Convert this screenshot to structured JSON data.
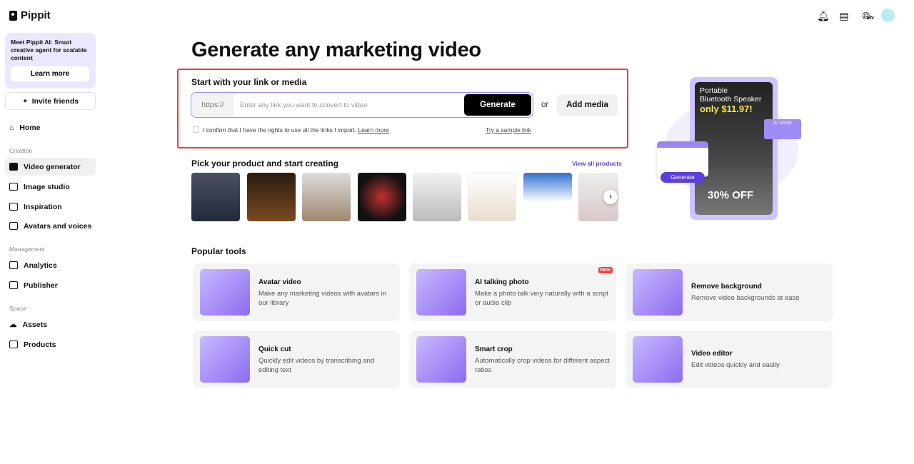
{
  "app": {
    "name": "Pippit"
  },
  "promo": {
    "text": "Meet Pippit AI: Smart creative agent for scalable content",
    "button": "Learn more"
  },
  "invite": "Invite friends",
  "nav": {
    "home": "Home",
    "creation": "Creation",
    "video_generator": "Video generator",
    "image_studio": "Image studio",
    "inspiration": "Inspiration",
    "avatars": "Avatars and voices",
    "management": "Management",
    "analytics": "Analytics",
    "publisher": "Publisher",
    "space": "Space",
    "assets": "Assets",
    "products": "Products"
  },
  "topbar": {
    "language": "EN"
  },
  "main": {
    "title": "Generate any marketing video",
    "link_box": {
      "title": "Start with your link or media",
      "prefix": "https://",
      "placeholder": "Enter any link you want to convert to video",
      "generate": "Generate",
      "or": "or",
      "add_media": "Add media",
      "confirm": "I confirm that I have the rights to use all the links I import.",
      "learn_more": "Learn more",
      "sample": "Try a sample link"
    },
    "products": {
      "title": "Pick your product and start creating",
      "view_all": "View all products"
    },
    "hero": {
      "line1": "Portable",
      "line2": "Bluetooth Speaker",
      "price": "only $11.97!",
      "discount": "30% OFF",
      "ai_voice": "AI Vocie",
      "generate": "Generate"
    },
    "popular": {
      "title": "Popular tools",
      "tools": [
        {
          "title": "Avatar video",
          "desc": "Make any marketing videos with avatars in our library"
        },
        {
          "title": "AI talking photo",
          "desc": "Make a photo talk very naturally with a script or audio clip",
          "badge": "New"
        },
        {
          "title": "Remove background",
          "desc": "Remove video backgrounds at ease"
        },
        {
          "title": "Quick cut",
          "desc": "Quickly edit videos by transcribing and editing text"
        },
        {
          "title": "Smart crop",
          "desc": "Automatically crop videos for different aspect ratios"
        },
        {
          "title": "Video editor",
          "desc": "Edit videos quickly and easily"
        }
      ]
    }
  }
}
